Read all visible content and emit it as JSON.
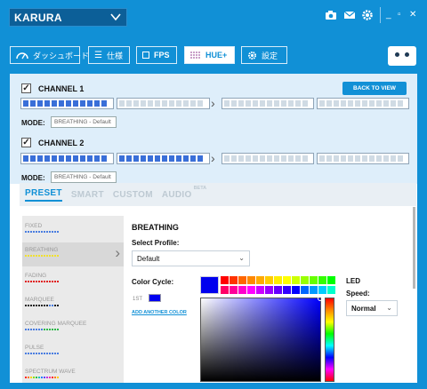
{
  "titlebar": {
    "profile_name": "KARURA",
    "icons": [
      "camera-icon",
      "mail-icon",
      "gear-icon"
    ],
    "window_controls": [
      "minimize",
      "restore",
      "close"
    ]
  },
  "nav": {
    "tabs": [
      {
        "label": "ダッシュボード",
        "icon": "gauge-icon"
      },
      {
        "label": "仕様",
        "icon": "list-icon"
      },
      {
        "label": "FPS",
        "icon": "square-icon"
      },
      {
        "label": "HUE+",
        "icon": "grid-icon",
        "active": true
      },
      {
        "label": "設定",
        "icon": "gear-icon"
      }
    ]
  },
  "channels": {
    "ch1": {
      "label": "CHANNEL 1",
      "checked": true,
      "mode_label": "MODE:",
      "mode": "BREATHING - Default"
    },
    "ch2": {
      "label": "CHANNEL 2",
      "checked": true,
      "mode_label": "MODE:",
      "mode": "BREATHING - Default"
    },
    "back_button": "BACK TO VIEW"
  },
  "tabs": {
    "preset": "PRESET",
    "smart": "SMART",
    "custom": "CUSTOM",
    "audio": "AUDIO",
    "beta": "BETA"
  },
  "effects": [
    {
      "label": "FIXED"
    },
    {
      "label": "BREATHING",
      "active": true
    },
    {
      "label": "FADING"
    },
    {
      "label": "MARQUEE"
    },
    {
      "label": "COVERING MARQUEE"
    },
    {
      "label": "PULSE"
    },
    {
      "label": "SPECTRUM WAVE"
    }
  ],
  "settings": {
    "title": "BREATHING",
    "select_profile_label": "Select Profile:",
    "profile_value": "Default",
    "color_cycle_label": "Color Cycle:",
    "first_label": "1ST",
    "add_color_link": "ADD ANOTHER COLOR",
    "led_label": "LED",
    "speed_label": "Speed:",
    "speed_value": "Normal"
  },
  "colors": {
    "accent": "#1190d6",
    "led_on": "#3a6fd8",
    "selected_color": "#0000ee"
  },
  "palette": [
    "#ff0000",
    "#ff3300",
    "#ff6600",
    "#ff8800",
    "#ffaa00",
    "#ffcc00",
    "#ffee00",
    "#ffff00",
    "#ccff00",
    "#99ff00",
    "#66ff00",
    "#33ff00",
    "#00ff00",
    "#ff0066",
    "#ff0099",
    "#ff00cc",
    "#ff00ff",
    "#cc00ff",
    "#9900ff",
    "#6600ff",
    "#3300ff",
    "#0000ff",
    "#0066ff",
    "#0099ff",
    "#00ccff",
    "#00ffcc"
  ]
}
